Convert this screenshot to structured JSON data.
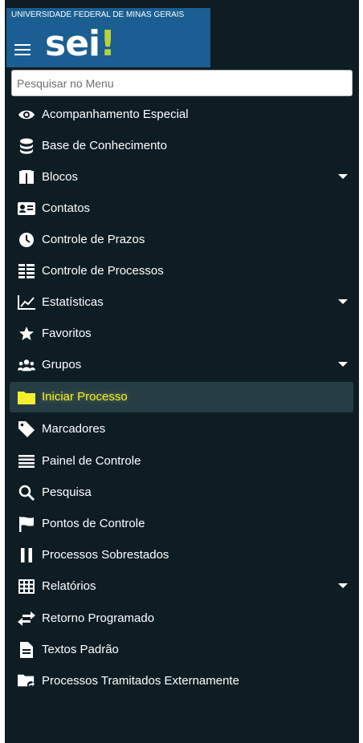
{
  "header": {
    "university": "UNIVERSIDADE FEDERAL DE MINAS GERAIS",
    "logo_text": "sei",
    "logo_mark": "!",
    "brand_color": "#1b5e91",
    "logo_accent": "#b7d337"
  },
  "search": {
    "placeholder": "Pesquisar no Menu",
    "value": ""
  },
  "menu": {
    "active_item": "Iniciar Processo",
    "highlight_color": "#f5ee30",
    "items": [
      {
        "label": "Acompanhamento Especial",
        "icon": "eye-icon",
        "submenu": false
      },
      {
        "label": "Base de Conhecimento",
        "icon": "database-icon",
        "submenu": false
      },
      {
        "label": "Blocos",
        "icon": "blocks-icon",
        "submenu": true
      },
      {
        "label": "Contatos",
        "icon": "address-card-icon",
        "submenu": false
      },
      {
        "label": "Controle de Prazos",
        "icon": "clock-icon",
        "submenu": false
      },
      {
        "label": "Controle de Processos",
        "icon": "list-icon",
        "submenu": false
      },
      {
        "label": "Estatísticas",
        "icon": "line-chart-icon",
        "submenu": true
      },
      {
        "label": "Favoritos",
        "icon": "star-icon",
        "submenu": false
      },
      {
        "label": "Grupos",
        "icon": "users-icon",
        "submenu": true
      },
      {
        "label": "Iniciar Processo",
        "icon": "folder-icon",
        "submenu": false,
        "active": true
      },
      {
        "label": "Marcadores",
        "icon": "tag-icon",
        "submenu": false
      },
      {
        "label": "Painel de Controle",
        "icon": "bars-icon",
        "submenu": false
      },
      {
        "label": "Pesquisa",
        "icon": "search-icon",
        "submenu": false
      },
      {
        "label": "Pontos de Controle",
        "icon": "flag-icon",
        "submenu": false
      },
      {
        "label": "Processos Sobrestados",
        "icon": "pause-icon",
        "submenu": false
      },
      {
        "label": "Relatórios",
        "icon": "table-icon",
        "submenu": true
      },
      {
        "label": "Retorno Programado",
        "icon": "exchange-icon",
        "submenu": false
      },
      {
        "label": "Textos Padrão",
        "icon": "file-text-icon",
        "submenu": false
      },
      {
        "label": "Processos Tramitados Externamente",
        "icon": "folder-share-icon",
        "submenu": false
      }
    ]
  }
}
